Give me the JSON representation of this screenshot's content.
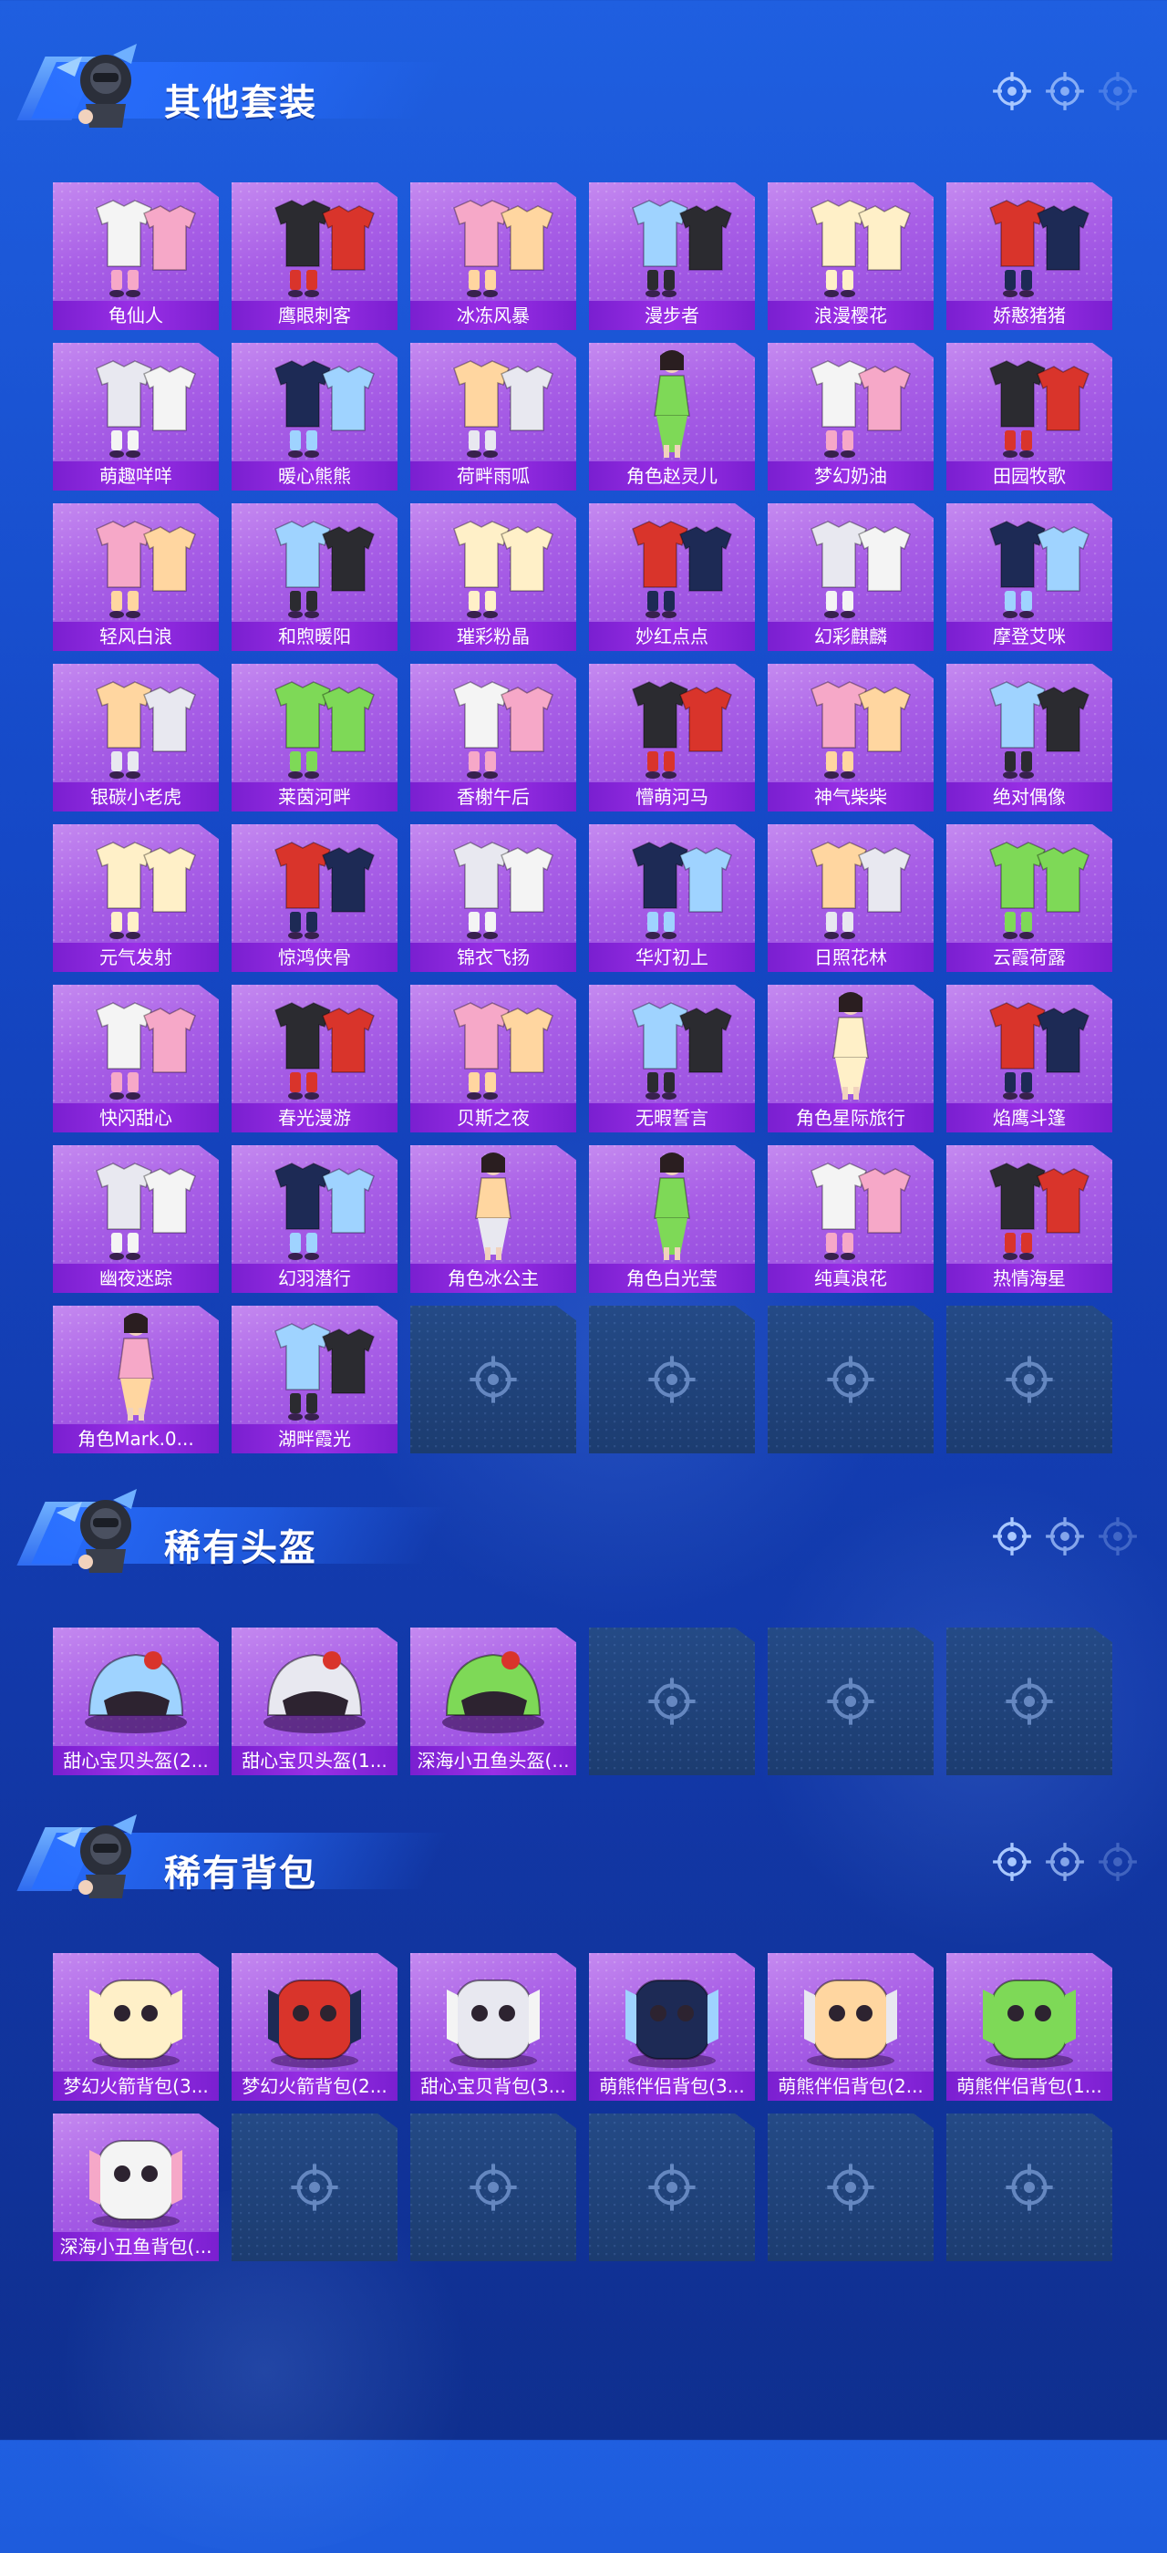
{
  "sections": [
    {
      "title": "其他套装",
      "items": [
        {
          "label": "龟仙人",
          "art": "outfit-icon"
        },
        {
          "label": "鹰眼刺客",
          "art": "outfit-icon"
        },
        {
          "label": "冰冻风暴",
          "art": "outfit-icon"
        },
        {
          "label": "漫步者",
          "art": "outfit-icon"
        },
        {
          "label": "浪漫樱花",
          "art": "outfit-icon"
        },
        {
          "label": "娇憨猪猪",
          "art": "outfit-icon"
        },
        {
          "label": "萌趣咩咩",
          "art": "outfit-icon"
        },
        {
          "label": "暖心熊熊",
          "art": "outfit-icon"
        },
        {
          "label": "荷畔雨呱",
          "art": "outfit-icon"
        },
        {
          "label": "角色赵灵儿",
          "art": "character-icon"
        },
        {
          "label": "梦幻奶油",
          "art": "outfit-icon"
        },
        {
          "label": "田园牧歌",
          "art": "outfit-icon"
        },
        {
          "label": "轻风白浪",
          "art": "outfit-icon"
        },
        {
          "label": "和煦暖阳",
          "art": "outfit-icon"
        },
        {
          "label": "璀彩粉晶",
          "art": "outfit-icon"
        },
        {
          "label": "妙红点点",
          "art": "outfit-icon"
        },
        {
          "label": "幻彩麒麟",
          "art": "outfit-icon"
        },
        {
          "label": "摩登艾咪",
          "art": "outfit-icon"
        },
        {
          "label": "银碳小老虎",
          "art": "outfit-icon"
        },
        {
          "label": "莱茵河畔",
          "art": "outfit-icon"
        },
        {
          "label": "香榭午后",
          "art": "outfit-icon"
        },
        {
          "label": "懵萌河马",
          "art": "outfit-icon"
        },
        {
          "label": "神气柴柴",
          "art": "outfit-icon"
        },
        {
          "label": "绝对偶像",
          "art": "outfit-icon"
        },
        {
          "label": "元气发射",
          "art": "outfit-icon"
        },
        {
          "label": "惊鸿侠骨",
          "art": "outfit-icon"
        },
        {
          "label": "锦衣飞扬",
          "art": "outfit-icon"
        },
        {
          "label": "华灯初上",
          "art": "outfit-icon"
        },
        {
          "label": "日照花林",
          "art": "outfit-icon"
        },
        {
          "label": "云霞荷露",
          "art": "outfit-icon"
        },
        {
          "label": "快闪甜心",
          "art": "outfit-icon"
        },
        {
          "label": "春光漫游",
          "art": "outfit-icon"
        },
        {
          "label": "贝斯之夜",
          "art": "outfit-icon"
        },
        {
          "label": "无暇誓言",
          "art": "outfit-icon"
        },
        {
          "label": "角色星际旅行",
          "art": "character-icon"
        },
        {
          "label": "焰鹰斗篷",
          "art": "outfit-icon"
        },
        {
          "label": "幽夜迷踪",
          "art": "outfit-icon"
        },
        {
          "label": "幻羽潜行",
          "art": "outfit-icon"
        },
        {
          "label": "角色冰公主",
          "art": "character-icon"
        },
        {
          "label": "角色白光莹",
          "art": "character-icon"
        },
        {
          "label": "纯真浪花",
          "art": "outfit-icon"
        },
        {
          "label": "热情海星",
          "art": "outfit-icon"
        },
        {
          "label": "角色Mark.0...",
          "art": "character-icon"
        },
        {
          "label": "湖畔霞光",
          "art": "outfit-icon"
        },
        null,
        null,
        null,
        null
      ]
    },
    {
      "title": "稀有头盔",
      "items": [
        {
          "label": "甜心宝贝头盔(2...",
          "art": "helmet-icon"
        },
        {
          "label": "甜心宝贝头盔(1...",
          "art": "helmet-icon"
        },
        {
          "label": "深海小丑鱼头盔(...",
          "art": "helmet-icon"
        },
        null,
        null,
        null
      ]
    },
    {
      "title": "稀有背包",
      "items": [
        {
          "label": "梦幻火箭背包(3...",
          "art": "backpack-icon"
        },
        {
          "label": "梦幻火箭背包(2...",
          "art": "backpack-icon"
        },
        {
          "label": "甜心宝贝背包(3...",
          "art": "backpack-icon"
        },
        {
          "label": "萌熊伴侣背包(3...",
          "art": "backpack-icon"
        },
        {
          "label": "萌熊伴侣背包(2...",
          "art": "backpack-icon"
        },
        {
          "label": "萌熊伴侣背包(1...",
          "art": "backpack-icon"
        },
        {
          "label": "深海小丑鱼背包(...",
          "art": "backpack-icon"
        },
        null,
        null,
        null,
        null,
        null
      ]
    }
  ]
}
